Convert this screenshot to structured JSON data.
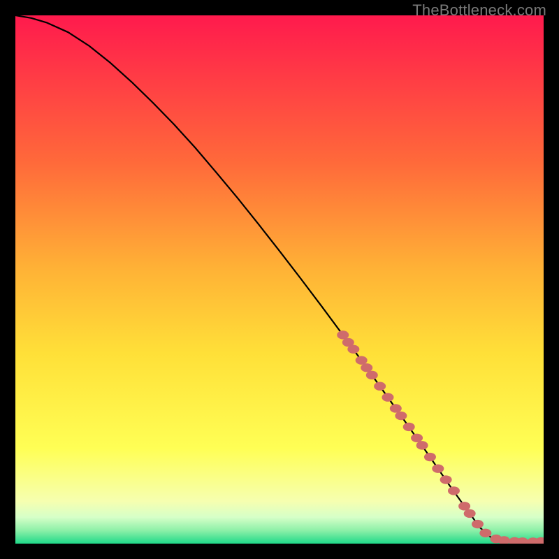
{
  "watermark": "TheBottleneck.com",
  "colors": {
    "background": "#000000",
    "curve": "#000000",
    "marker_fill": "#cf6b6b",
    "marker_stroke": "#cf6b6b",
    "gradient_top": "#ff1a4d",
    "gradient_g2": "#ff6a3a",
    "gradient_g3": "#ffb236",
    "gradient_g4": "#ffe038",
    "gradient_g5": "#ffff55",
    "gradient_g6": "#f6ffb0",
    "gradient_g7": "#d6ffc8",
    "gradient_g8": "#8df0a8",
    "gradient_bottom": "#1fd989"
  },
  "chart_data": {
    "type": "line",
    "title": "",
    "xlabel": "",
    "ylabel": "",
    "xlim": [
      0,
      100
    ],
    "ylim": [
      0,
      100
    ],
    "series": [
      {
        "name": "bottleneck-curve",
        "x": [
          0,
          3,
          6,
          10,
          14,
          18,
          22,
          26,
          30,
          34,
          38,
          42,
          46,
          50,
          54,
          58,
          62,
          66,
          70,
          74,
          78,
          80,
          82,
          84,
          86,
          88,
          90,
          92,
          94,
          96,
          98,
          100
        ],
        "y": [
          100,
          99.5,
          98.6,
          96.8,
          94.2,
          91.0,
          87.4,
          83.5,
          79.4,
          75.0,
          70.3,
          65.5,
          60.5,
          55.4,
          50.2,
          44.9,
          39.5,
          34.0,
          28.4,
          22.8,
          17.1,
          14.2,
          11.3,
          8.5,
          5.7,
          3.0,
          1.2,
          0.5,
          0.35,
          0.3,
          0.3,
          0.4
        ]
      }
    ],
    "markers": {
      "name": "highlighted-range",
      "x": [
        62,
        63,
        64,
        65.5,
        66.5,
        67.5,
        69,
        70.5,
        72,
        73,
        74.5,
        76,
        77,
        78.5,
        80,
        81.5,
        83,
        85,
        86,
        87.5,
        89,
        91,
        92.5,
        94.5,
        96,
        98,
        99.5
      ],
      "y": [
        39.5,
        38.1,
        36.8,
        34.7,
        33.3,
        31.9,
        29.8,
        27.7,
        25.6,
        24.2,
        22.1,
        20.0,
        18.6,
        16.4,
        14.2,
        12.1,
        10.0,
        7.1,
        5.7,
        3.7,
        2.0,
        0.9,
        0.6,
        0.4,
        0.35,
        0.33,
        0.38
      ]
    }
  }
}
